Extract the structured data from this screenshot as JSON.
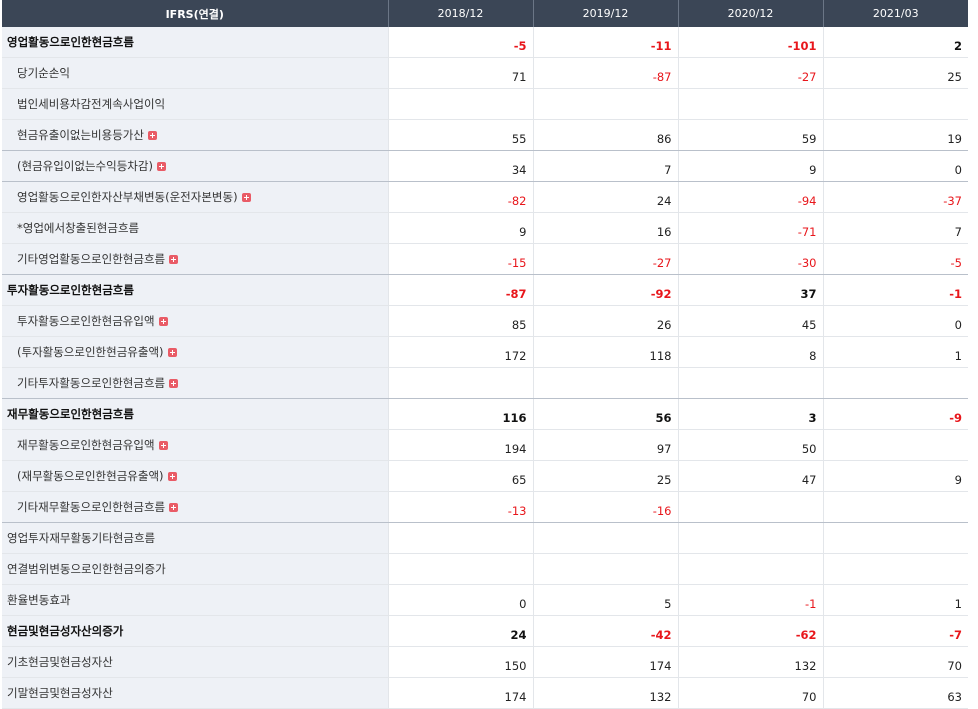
{
  "header": {
    "label_col": "IFRS(연결)",
    "periods": [
      "2018/12",
      "2019/12",
      "2020/12",
      "2021/03"
    ]
  },
  "rows": [
    {
      "label": "영업활동으로인한현금흐름",
      "values": [
        "-5",
        "-11",
        "-101",
        "2"
      ],
      "bold": true,
      "indent": false,
      "expand": false,
      "sep": false
    },
    {
      "label": "당기순손익",
      "values": [
        "71",
        "-87",
        "-27",
        "25"
      ],
      "bold": false,
      "indent": true,
      "expand": false,
      "sep": false
    },
    {
      "label": "법인세비용차감전계속사업이익",
      "values": [
        "",
        "",
        "",
        ""
      ],
      "bold": false,
      "indent": true,
      "expand": false,
      "sep": false
    },
    {
      "label": "현금유출이없는비용등가산",
      "values": [
        "55",
        "86",
        "59",
        "19"
      ],
      "bold": false,
      "indent": true,
      "expand": true,
      "sep": true
    },
    {
      "label": "(현금유입이없는수익등차감)",
      "values": [
        "34",
        "7",
        "9",
        "0"
      ],
      "bold": false,
      "indent": true,
      "expand": true,
      "sep": true
    },
    {
      "label": "영업활동으로인한자산부채변동(운전자본변동)",
      "values": [
        "-82",
        "24",
        "-94",
        "-37"
      ],
      "bold": false,
      "indent": true,
      "expand": true,
      "sep": false
    },
    {
      "label": "*영업에서창출된현금흐름",
      "values": [
        "9",
        "16",
        "-71",
        "7"
      ],
      "bold": false,
      "indent": true,
      "expand": false,
      "sep": false
    },
    {
      "label": "기타영업활동으로인한현금흐름",
      "values": [
        "-15",
        "-27",
        "-30",
        "-5"
      ],
      "bold": false,
      "indent": true,
      "expand": true,
      "sep": true
    },
    {
      "label": "투자활동으로인한현금흐름",
      "values": [
        "-87",
        "-92",
        "37",
        "-1"
      ],
      "bold": true,
      "indent": false,
      "expand": false,
      "sep": false
    },
    {
      "label": "투자활동으로인한현금유입액",
      "values": [
        "85",
        "26",
        "45",
        "0"
      ],
      "bold": false,
      "indent": true,
      "expand": true,
      "sep": false
    },
    {
      "label": "(투자활동으로인한현금유출액)",
      "values": [
        "172",
        "118",
        "8",
        "1"
      ],
      "bold": false,
      "indent": true,
      "expand": true,
      "sep": false
    },
    {
      "label": "기타투자활동으로인한현금흐름",
      "values": [
        "",
        "",
        "",
        ""
      ],
      "bold": false,
      "indent": true,
      "expand": true,
      "sep": true
    },
    {
      "label": "재무활동으로인한현금흐름",
      "values": [
        "116",
        "56",
        "3",
        "-9"
      ],
      "bold": true,
      "indent": false,
      "expand": false,
      "sep": false
    },
    {
      "label": "재무활동으로인한현금유입액",
      "values": [
        "194",
        "97",
        "50",
        ""
      ],
      "bold": false,
      "indent": true,
      "expand": true,
      "sep": false
    },
    {
      "label": "(재무활동으로인한현금유출액)",
      "values": [
        "65",
        "25",
        "47",
        "9"
      ],
      "bold": false,
      "indent": true,
      "expand": true,
      "sep": false
    },
    {
      "label": "기타재무활동으로인한현금흐름",
      "values": [
        "-13",
        "-16",
        "",
        ""
      ],
      "bold": false,
      "indent": true,
      "expand": true,
      "sep": true
    },
    {
      "label": "영업투자재무활동기타현금흐름",
      "values": [
        "",
        "",
        "",
        ""
      ],
      "bold": false,
      "indent": false,
      "expand": false,
      "sep": false
    },
    {
      "label": "연결범위변동으로인한현금의증가",
      "values": [
        "",
        "",
        "",
        ""
      ],
      "bold": false,
      "indent": false,
      "expand": false,
      "sep": false
    },
    {
      "label": "환율변동효과",
      "values": [
        "0",
        "5",
        "-1",
        "1"
      ],
      "bold": false,
      "indent": false,
      "expand": false,
      "sep": false
    },
    {
      "label": "현금및현금성자산의증가",
      "values": [
        "24",
        "-42",
        "-62",
        "-7"
      ],
      "bold": true,
      "indent": false,
      "expand": false,
      "sep": false
    },
    {
      "label": "기초현금및현금성자산",
      "values": [
        "150",
        "174",
        "132",
        "70"
      ],
      "bold": false,
      "indent": false,
      "expand": false,
      "sep": false
    },
    {
      "label": "기말현금및현금성자산",
      "values": [
        "174",
        "132",
        "70",
        "63"
      ],
      "bold": false,
      "indent": false,
      "expand": false,
      "sep": false
    }
  ],
  "icons": {
    "expand": "plus-icon"
  },
  "colors": {
    "header_bg": "#3b4656",
    "label_bg": "#eef1f6",
    "negative": "#e8161b",
    "expand_icon": "#e95b66"
  }
}
